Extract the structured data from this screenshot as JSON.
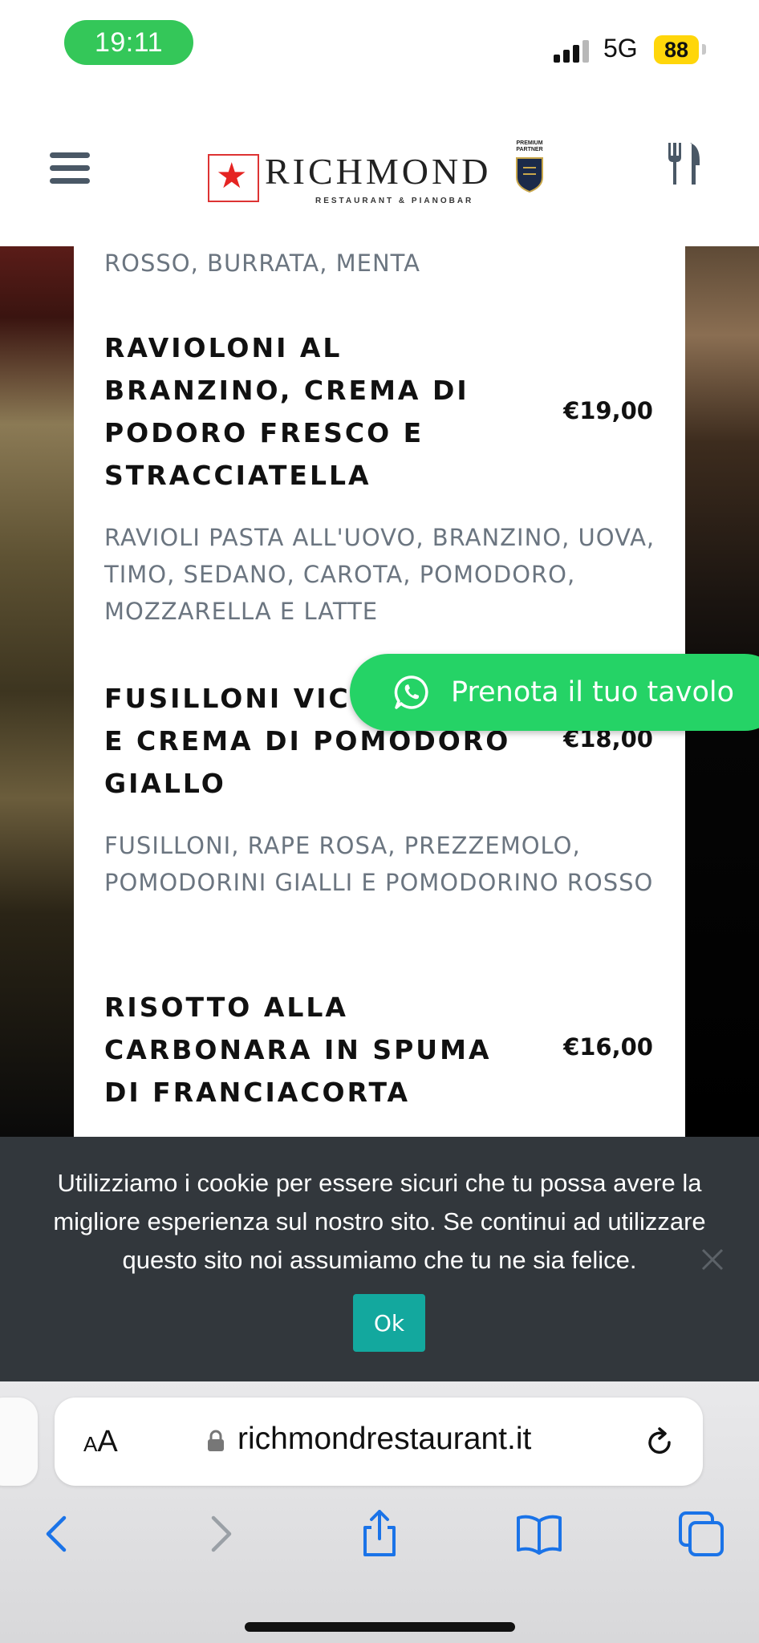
{
  "status_bar": {
    "time": "19:11",
    "network": "5G",
    "battery": "88"
  },
  "header": {
    "logo_name": "RICHMOND",
    "logo_subtitle": "RESTAURANT & PIANOBAR",
    "partner_label": "PREMIUM PARTNER"
  },
  "menu": {
    "prev_desc_tail": "ROSSO, BURRATA, MENTA",
    "dishes": [
      {
        "name": "RAVIOLONI AL BRANZINO, CREMA DI PODORO FRESCO E STRACCIATELLA",
        "price": "€19,00",
        "description": "RAVIOLI PASTA ALL'UOVO, BRANZINO, UOVA, TIMO, SEDANO, CAROTA, POMODORO, MOZZARELLA E LATTE"
      },
      {
        "name": "FUSILLONI VIC BACCALA' E CREMA DI POMODORO GIALLO",
        "price": "€18,00",
        "description": "FUSILLONI, RAPE ROSA, PREZZEMOLO, POMODORINI GIALLI E POMODORINO ROSSO"
      },
      {
        "name": "RISOTTO ALLA CARBONARA IN SPUMA DI FRANCIACORTA",
        "price": "€16,00"
      }
    ]
  },
  "whatsapp": {
    "label": "Prenota il tuo tavolo"
  },
  "cookie": {
    "text": "Utilizziamo i cookie per essere sicuri che tu possa avere la migliore esperienza sul nostro sito. Se continui ad utilizzare questo sito noi assumiamo che tu ne sia felice.",
    "ok_label": "Ok"
  },
  "browser": {
    "aa_small": "A",
    "aa_big": "A",
    "url": "richmondrestaurant.it"
  },
  "colors": {
    "whatsapp_green": "#25d366",
    "cookie_bg": "#32373c",
    "ok_button": "#13a89e",
    "time_pill": "#34c759",
    "battery": "#ffd60a",
    "browser_accent": "#1a73e8"
  },
  "icons": [
    "menu-icon",
    "cutlery-icon",
    "whatsapp-icon",
    "close-icon",
    "lock-icon",
    "reload-icon",
    "back-icon",
    "forward-icon",
    "share-icon",
    "bookmarks-icon",
    "tabs-icon"
  ]
}
